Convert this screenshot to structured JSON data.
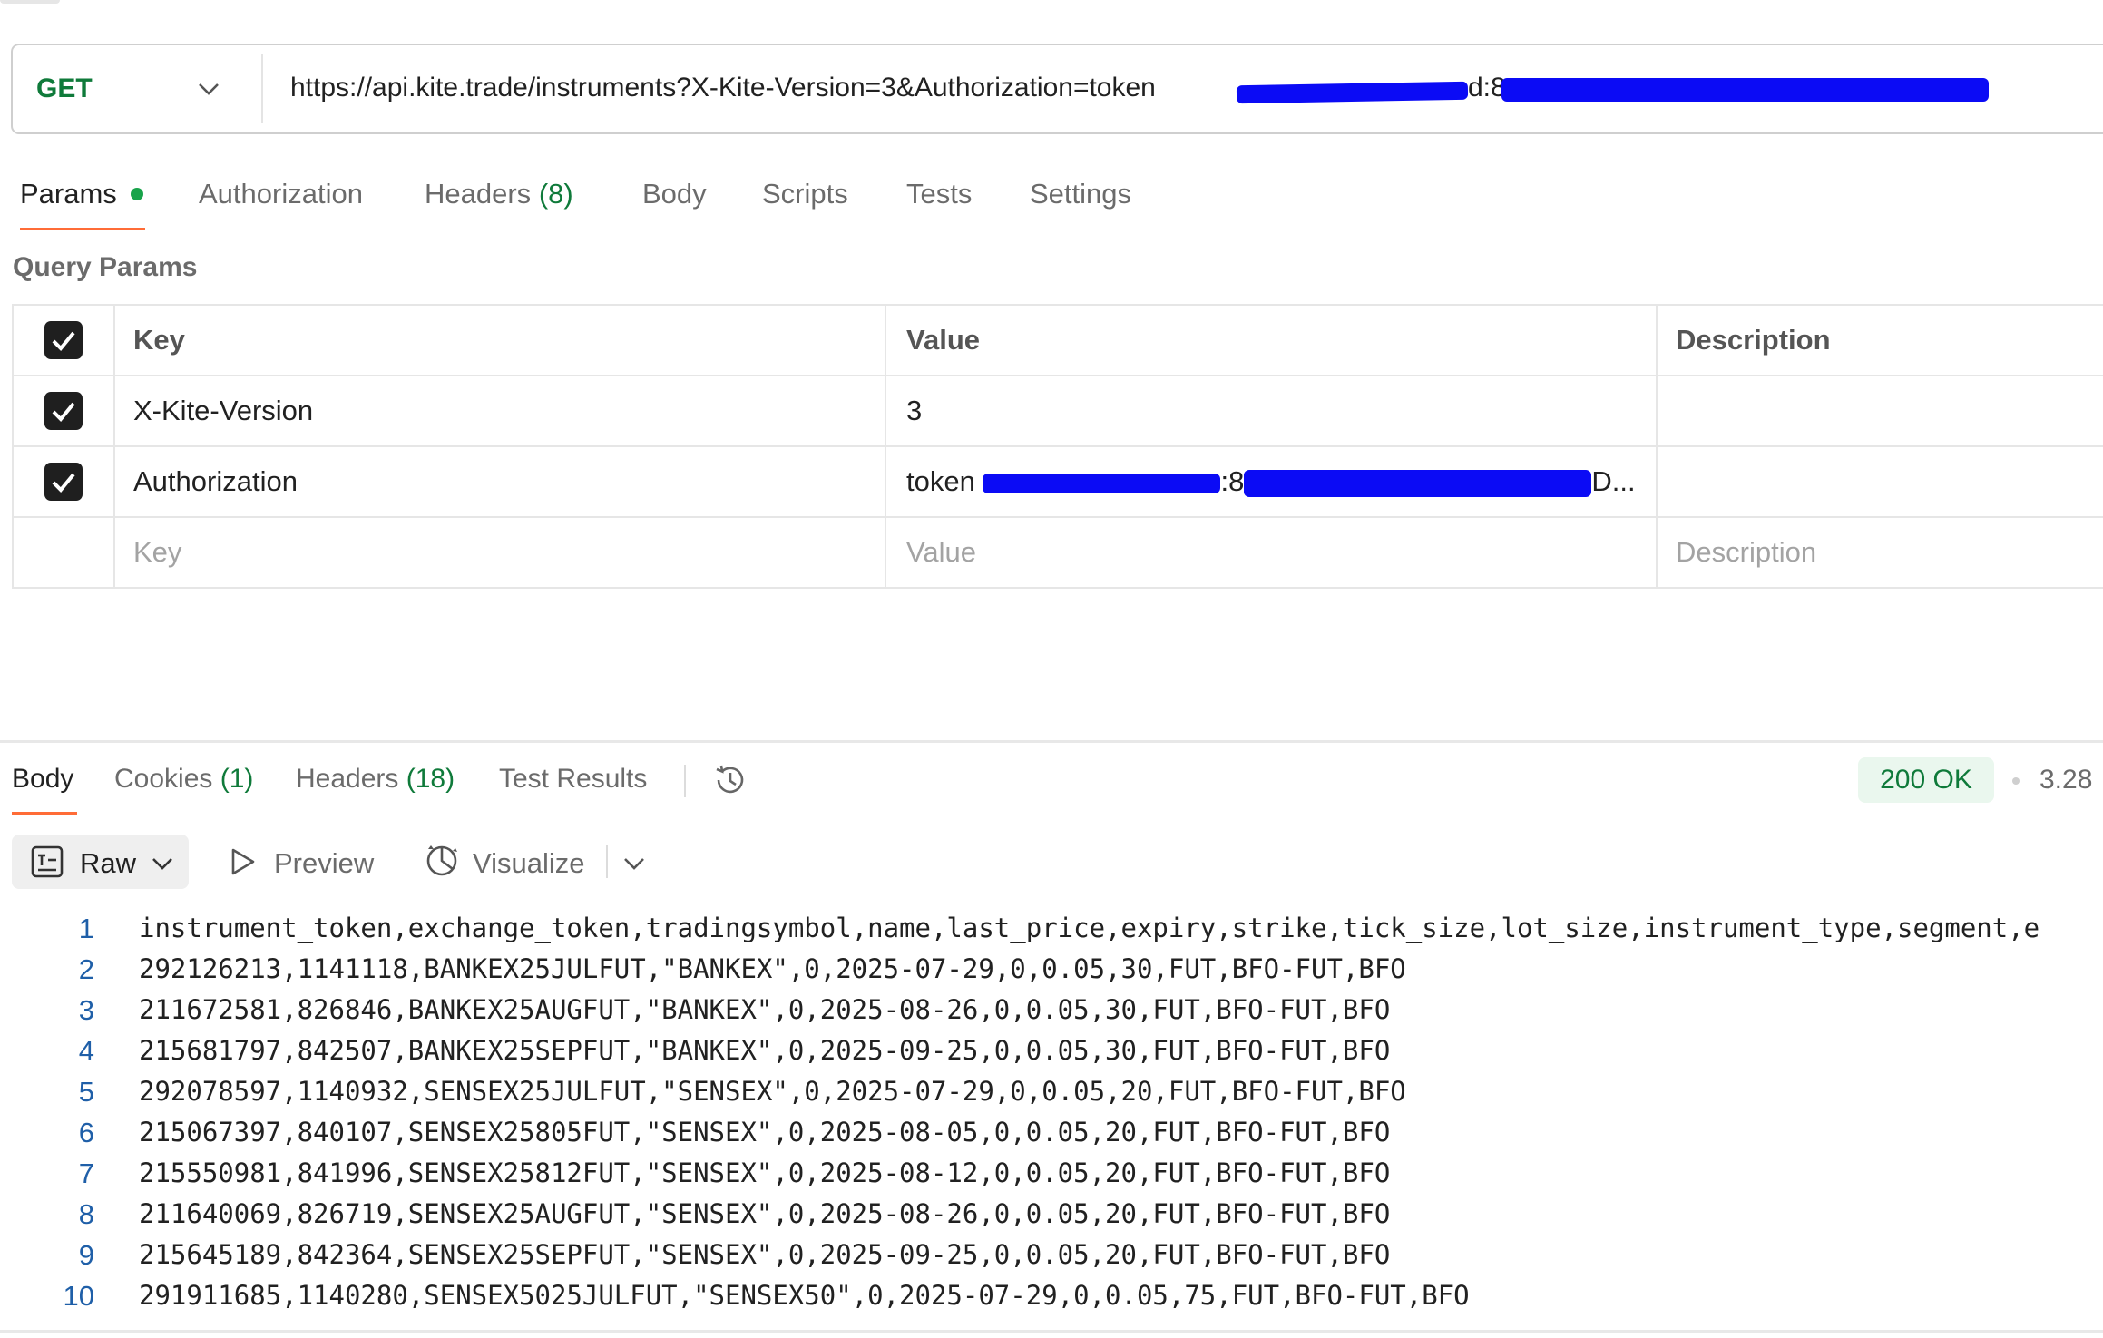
{
  "request": {
    "method": "GET",
    "url_visible": "https://api.kite.trade/instruments?X-Kite-Version=3&Authorization=token",
    "url_redacted_suffix": "d:8"
  },
  "request_tabs": [
    {
      "label": "Params",
      "count": ""
    },
    {
      "label": "Authorization",
      "count": ""
    },
    {
      "label": "Headers",
      "count": "(8)"
    },
    {
      "label": "Body",
      "count": ""
    },
    {
      "label": "Scripts",
      "count": ""
    },
    {
      "label": "Tests",
      "count": ""
    },
    {
      "label": "Settings",
      "count": ""
    }
  ],
  "query_params": {
    "title": "Query Params",
    "headers": {
      "key": "Key",
      "value": "Value",
      "description": "Description"
    },
    "rows": [
      {
        "key": "X-Kite-Version",
        "value": "3",
        "description": ""
      },
      {
        "key": "Authorization",
        "value_prefix": "token",
        "value_mid": ":8",
        "value_suffix": "D...",
        "description": ""
      }
    ],
    "placeholders": {
      "key": "Key",
      "value": "Value",
      "description": "Description"
    }
  },
  "response_tabs": [
    {
      "label": "Body",
      "count": ""
    },
    {
      "label": "Cookies",
      "count": "(1)"
    },
    {
      "label": "Headers",
      "count": "(18)"
    },
    {
      "label": "Test Results",
      "count": ""
    }
  ],
  "response_status": "200 OK",
  "response_time": "3.28",
  "view_toolbar": {
    "raw": "Raw",
    "preview": "Preview",
    "visualize": "Visualize"
  },
  "body_lines": [
    {
      "n": "1",
      "text": "instrument_token,exchange_token,tradingsymbol,name,last_price,expiry,strike,tick_size,lot_size,instrument_type,segment,e"
    },
    {
      "n": "2",
      "text": "292126213,1141118,BANKEX25JULFUT,\"BANKEX\",0,2025-07-29,0,0.05,30,FUT,BFO-FUT,BFO"
    },
    {
      "n": "3",
      "text": "211672581,826846,BANKEX25AUGFUT,\"BANKEX\",0,2025-08-26,0,0.05,30,FUT,BFO-FUT,BFO"
    },
    {
      "n": "4",
      "text": "215681797,842507,BANKEX25SEPFUT,\"BANKEX\",0,2025-09-25,0,0.05,30,FUT,BFO-FUT,BFO"
    },
    {
      "n": "5",
      "text": "292078597,1140932,SENSEX25JULFUT,\"SENSEX\",0,2025-07-29,0,0.05,20,FUT,BFO-FUT,BFO"
    },
    {
      "n": "6",
      "text": "215067397,840107,SENSEX25805FUT,\"SENSEX\",0,2025-08-05,0,0.05,20,FUT,BFO-FUT,BFO"
    },
    {
      "n": "7",
      "text": "215550981,841996,SENSEX25812FUT,\"SENSEX\",0,2025-08-12,0,0.05,20,FUT,BFO-FUT,BFO"
    },
    {
      "n": "8",
      "text": "211640069,826719,SENSEX25AUGFUT,\"SENSEX\",0,2025-08-26,0,0.05,20,FUT,BFO-FUT,BFO"
    },
    {
      "n": "9",
      "text": "215645189,842364,SENSEX25SEPFUT,\"SENSEX\",0,2025-09-25,0,0.05,20,FUT,BFO-FUT,BFO"
    },
    {
      "n": "10",
      "text": "291911685,1140280,SENSEX5025JULFUT,\"SENSEX50\",0,2025-07-29,0,0.05,75,FUT,BFO-FUT,BFO"
    }
  ],
  "colors": {
    "accent": "#ff6c37",
    "method": "#0f7a3a",
    "redaction": "#0b0bf5",
    "line_numbers": "#1f5fa8"
  },
  "icons": [
    "chevron-down-icon",
    "checkbox-checked-icon",
    "history-icon",
    "raw-format-icon",
    "play-icon",
    "visualize-icon"
  ]
}
